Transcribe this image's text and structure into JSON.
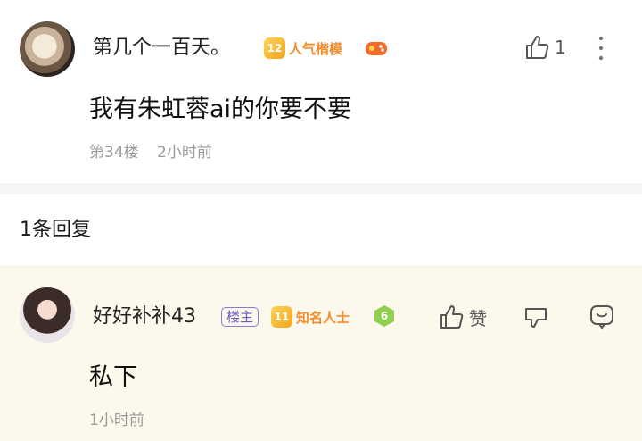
{
  "main_comment": {
    "username": "第几个一百天。",
    "level": "12",
    "badge": "人气楷模",
    "content": "我有朱虹蓉ai的你要不要",
    "floor": "第34楼",
    "time": "2小时前",
    "like_count": "1"
  },
  "replies_section": {
    "title": "1条回复"
  },
  "reply": {
    "username": "好好补补43",
    "owner_tag": "楼主",
    "level": "11",
    "badge": "知名人士",
    "badge2": "6",
    "content": "私下",
    "time": "1小时前",
    "like_label": "赞"
  },
  "colors": {
    "reply_bg": "#fdf8ec",
    "level_orange": "#f28b2a",
    "owner_purple": "#6a5bbf"
  }
}
